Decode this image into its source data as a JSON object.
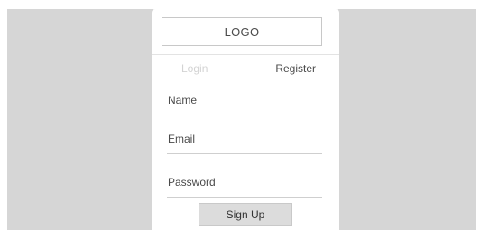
{
  "header": {
    "logo_text": "LOGO"
  },
  "tabs": {
    "login_label": "Login",
    "register_label": "Register",
    "active": "Register"
  },
  "form": {
    "name_placeholder": "Name",
    "email_placeholder": "Email",
    "password_placeholder": "Password",
    "submit_label": "Sign Up"
  },
  "colors": {
    "backdrop": "#d6d6d6",
    "card": "#ffffff",
    "inactive_tab": "#d3d3d3",
    "button": "#dcdcdc"
  }
}
